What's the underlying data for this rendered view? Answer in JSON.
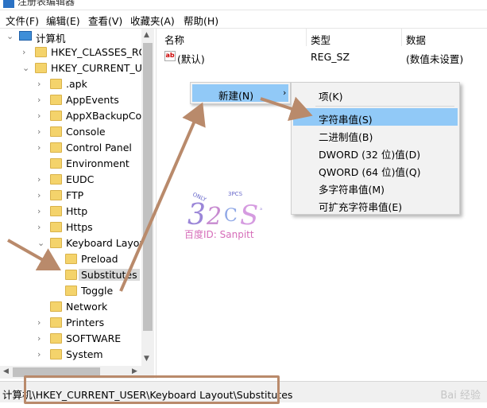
{
  "window": {
    "title": "注册表编辑器"
  },
  "menubar": {
    "items": [
      "文件(F)",
      "编辑(E)",
      "查看(V)",
      "收藏夹(A)",
      "帮助(H)"
    ]
  },
  "tree": {
    "root": "计算机",
    "items": [
      "HKEY_CLASSES_ROOT",
      "HKEY_CURRENT_USER",
      ".apk",
      "AppEvents",
      "AppXBackupCor",
      "Console",
      "Control Panel",
      "Environment",
      "EUDC",
      "FTP",
      "Http",
      "Https",
      "Keyboard Layout",
      "Preload",
      "Substitutes",
      "Toggle",
      "Network",
      "Printers",
      "SOFTWARE",
      "System"
    ]
  },
  "list": {
    "columns": [
      "名称",
      "类型",
      "数据"
    ],
    "rows": [
      {
        "name": "(默认)",
        "type": "REG_SZ",
        "data": "(数值未设置)"
      }
    ]
  },
  "context_menu": {
    "item": "新建(N)",
    "submenu": [
      "项(K)",
      "字符串值(S)",
      "二进制值(B)",
      "DWORD (32 位)值(D)",
      "QWORD (64 位)值(Q)",
      "多字符串值(M)",
      "可扩充字符串值(E)"
    ]
  },
  "statusbar": {
    "path": "计算机\\HKEY_CURRENT_USER\\Keyboard Layout\\Substitutes"
  },
  "watermark": {
    "text": "百度ID: Sanpitt",
    "corner": "Bai 经验"
  },
  "colors": {
    "highlight": "#91c9f7",
    "annotation": "#b98a6b",
    "folder": "#f4d36b"
  }
}
